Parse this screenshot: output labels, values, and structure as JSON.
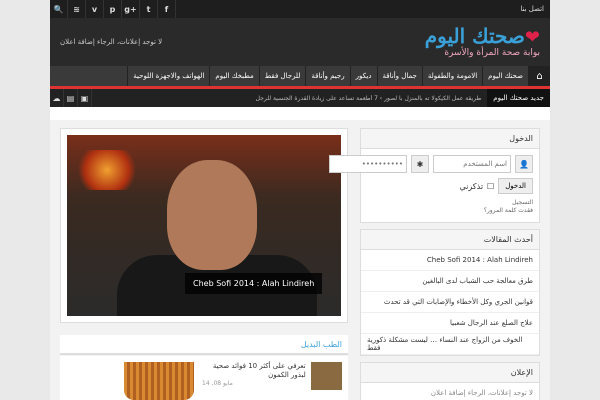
{
  "topbar": {
    "contact": "اتصل بنا",
    "social": [
      "f",
      "t",
      "g+",
      "p",
      "v",
      "rss",
      "🔍"
    ]
  },
  "header": {
    "ad": "لا توجد إعلانات، الرجاء إضافة اعلان",
    "logo_main": "صحتك اليوم",
    "logo_sub": "بوابة صحة المرأة والأسرة"
  },
  "nav": {
    "home": "⌂",
    "items": [
      "صحتك اليوم",
      "الامومة والطفولة",
      "جمال وأناقة",
      "ديكور",
      "رجيم وأناقة",
      "للرجال فقط",
      "مطبخك اليوم",
      "الهواتف والاجهزة اللوحية"
    ]
  },
  "ticker": {
    "label": "جديد صحتك اليوم",
    "text": "طريقة عمل الكيكولا ته بالمنزل با لصور › 7 أطعمة تساعد على زيادة القدرة الجنسية للرجل"
  },
  "slider": {
    "caption": "Cheb Sofi 2014 : Alah Lindireh"
  },
  "section": {
    "title": "الطب البديل"
  },
  "posts": [
    {
      "title": "تعرفي على أكثر 10 فوائد صحية لبذور الكمون",
      "date": "14 ,08 مايو"
    }
  ],
  "sidebar": {
    "login_title": "الدخول",
    "username_placeholder": "اسم المستخدم",
    "password_placeholder": "••••••••••",
    "remember": "تذكرني",
    "login_button": "الدخول",
    "register": "التسجيل",
    "lost_password": "فقدت كلمة المرور؟",
    "recent_title": "أحدث المقالات",
    "recent": [
      "Cheb Sofi 2014 : Alah Lindireh",
      "طرق معالجة حب الشباب لدى البالغين",
      "قوانين الجري وكل الأخطاء والإصابات التي قد تحدث",
      "علاج الصلع عند الرجال شعبيا",
      "الخوف من الزواج عند النساء … ليست مشكلة ذكورية فقط"
    ],
    "ad_title": "الإعلان",
    "ad_text": "لا توجد إعلانات، الرجاء إضافة اعلان"
  }
}
